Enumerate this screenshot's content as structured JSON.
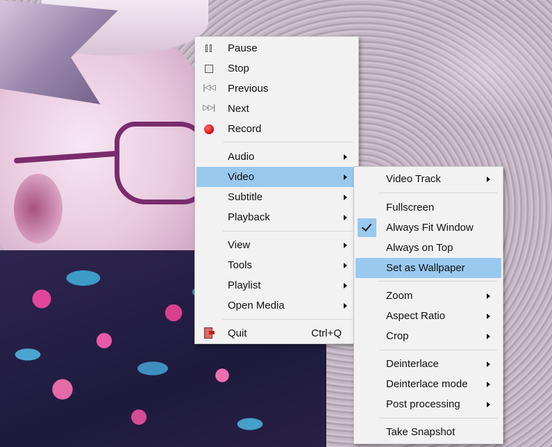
{
  "main_menu": {
    "pause": "Pause",
    "stop": "Stop",
    "previous": "Previous",
    "next": "Next",
    "record": "Record",
    "audio": "Audio",
    "video": "Video",
    "subtitle": "Subtitle",
    "playback": "Playback",
    "view": "View",
    "tools": "Tools",
    "playlist": "Playlist",
    "open_media": "Open Media",
    "quit": "Quit",
    "quit_shortcut": "Ctrl+Q",
    "highlighted_item": "Video"
  },
  "video_submenu": {
    "video_track": "Video Track",
    "fullscreen": "Fullscreen",
    "always_fit_window": "Always Fit Window",
    "always_fit_window_checked": true,
    "always_on_top": "Always on Top",
    "set_as_wallpaper": "Set as Wallpaper",
    "zoom": "Zoom",
    "aspect_ratio": "Aspect Ratio",
    "crop": "Crop",
    "deinterlace": "Deinterlace",
    "deinterlace_mode": "Deinterlace mode",
    "post_processing": "Post processing",
    "take_snapshot": "Take Snapshot",
    "highlighted_item": "Set as Wallpaper"
  },
  "colors": {
    "menu_bg": "#f2f2f2",
    "highlight": "#99c9ef",
    "record_red": "#d10d0d"
  },
  "icons": {
    "pause": "pause-icon",
    "stop": "stop-icon",
    "previous": "previous-icon",
    "next": "next-icon",
    "record": "record-icon",
    "quit": "quit-icon",
    "check": "check-icon",
    "submenu": "chevron-right-icon"
  }
}
